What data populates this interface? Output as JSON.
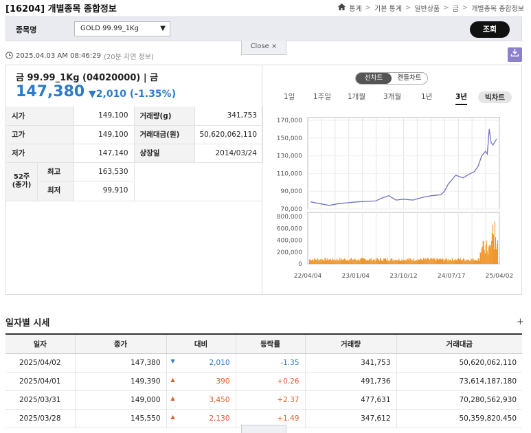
{
  "header": {
    "title": "[16204] 개별종목 종합정보",
    "breadcrumb": [
      "통계",
      "기본 통계",
      "일반상품",
      "금",
      "개별종목 종합정보"
    ]
  },
  "search": {
    "label": "종목명",
    "selected": "GOLD 99.99_1Kg",
    "button": "조회"
  },
  "close_tab": {
    "label": "Close",
    "icon": "×"
  },
  "timestamp": {
    "text": "2025.04.03 AM 08:46:29",
    "note": "(20분 지연 정보)"
  },
  "stock": {
    "name": "금 99.99_1Kg (04020000) | 금",
    "price": "147,380",
    "change": "▼2,010 (-1.35%)"
  },
  "info": {
    "open_label": "시가",
    "open": "149,100",
    "volume_label": "거래량(g)",
    "volume": "341,753",
    "high_label": "고가",
    "high": "149,100",
    "amount_label": "거래대금(원)",
    "amount": "50,620,062,110",
    "low_label": "저가",
    "low": "147,140",
    "listing_label": "상장일",
    "listing": "2014/03/24",
    "w52_label": "52주\n(종가)",
    "w52_high_label": "최고",
    "w52_high": "163,530",
    "w52_low_label": "최저",
    "w52_low": "99,910"
  },
  "chart_tabs": {
    "line": "선차트",
    "candle": "캔들차트"
  },
  "periods": [
    "1일",
    "1주일",
    "1개월",
    "3개월",
    "1년",
    "3년",
    "빅차트"
  ],
  "chart_data": {
    "type": "line",
    "x_ticks": [
      "22/04/04",
      "23/01/04",
      "23/10/12",
      "24/07/17",
      "25/04/02"
    ],
    "price_y_ticks": [
      "170,000",
      "150,000",
      "130,000",
      "110,000",
      "90,000",
      "70,000"
    ],
    "price_ylim": [
      70000,
      170000
    ],
    "price_points": [
      [
        0,
        78000
      ],
      [
        0.05,
        76000
      ],
      [
        0.1,
        74000
      ],
      [
        0.15,
        76000
      ],
      [
        0.2,
        77000
      ],
      [
        0.25,
        78000
      ],
      [
        0.3,
        78500
      ],
      [
        0.35,
        79000
      ],
      [
        0.38,
        82000
      ],
      [
        0.42,
        85000
      ],
      [
        0.46,
        80000
      ],
      [
        0.5,
        81000
      ],
      [
        0.55,
        80000
      ],
      [
        0.6,
        83000
      ],
      [
        0.65,
        85000
      ],
      [
        0.7,
        86000
      ],
      [
        0.72,
        90000
      ],
      [
        0.74,
        98000
      ],
      [
        0.78,
        108000
      ],
      [
        0.82,
        105000
      ],
      [
        0.85,
        109000
      ],
      [
        0.88,
        112000
      ],
      [
        0.9,
        118000
      ],
      [
        0.92,
        130000
      ],
      [
        0.94,
        135000
      ],
      [
        0.95,
        132000
      ],
      [
        0.96,
        160000
      ],
      [
        0.97,
        145000
      ],
      [
        0.98,
        142000
      ],
      [
        1.0,
        149000
      ]
    ],
    "volume_y_ticks": [
      "800,000",
      "600,000",
      "400,000",
      "200,000",
      "0"
    ],
    "volume_ylim": [
      0,
      800000
    ]
  },
  "daily": {
    "title": "일자별 시세",
    "plus": "+",
    "columns": [
      "일자",
      "종가",
      "대비",
      "등락률",
      "거래량",
      "거래대금"
    ],
    "rows": [
      {
        "date": "2025/04/02",
        "close": "147,380",
        "dir": "▼",
        "diff": "2,010",
        "rate": "-1.35",
        "vol": "341,753",
        "amt": "50,620,062,110",
        "cls": "dn"
      },
      {
        "date": "2025/04/01",
        "close": "149,390",
        "dir": "▲",
        "diff": "390",
        "rate": "+0.26",
        "vol": "491,736",
        "amt": "73,614,187,180",
        "cls": "up"
      },
      {
        "date": "2025/03/31",
        "close": "149,000",
        "dir": "▲",
        "diff": "3,450",
        "rate": "+2.37",
        "vol": "477,631",
        "amt": "70,280,562,930",
        "cls": "up"
      },
      {
        "date": "2025/03/28",
        "close": "145,550",
        "dir": "▲",
        "diff": "2,130",
        "rate": "+1.49",
        "vol": "347,612",
        "amt": "50,359,820,450",
        "cls": "up"
      }
    ]
  }
}
